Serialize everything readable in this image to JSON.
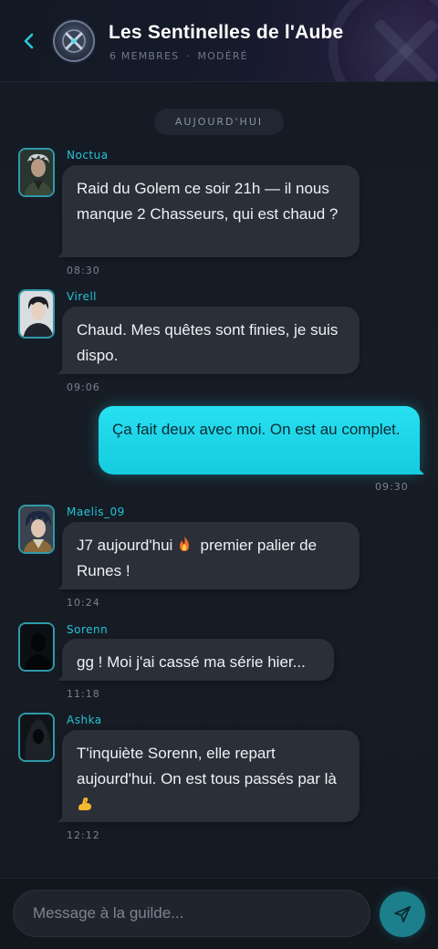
{
  "header": {
    "title": "Les Sentinelles de l'Aube",
    "members": "6 MEMBRES",
    "separator": "·",
    "moderation": "MODÉRÉ"
  },
  "day_divider": "AUJOURD'HUI",
  "messages": [
    {
      "sender": "Noctua",
      "text": "Raid du Golem ce soir 21h — il nous manque 2 Chasseurs, qui est chaud ?",
      "time": "08:30"
    },
    {
      "sender": "Virell",
      "text": "Chaud. Mes quêtes sont finies, je suis dispo.",
      "time": "09:06"
    },
    {
      "sender": "",
      "text": "Ça fait deux avec moi. On est au complet.",
      "time": "09:30"
    },
    {
      "sender": "Maelis_09",
      "text_before": "J7 aujourd'hui",
      "text_after": "premier palier de Runes !",
      "time": "10:24"
    },
    {
      "sender": "Sorenn",
      "text": "gg ! Moi j'ai cassé ma série hier...",
      "time": "11:18"
    },
    {
      "sender": "Ashka",
      "text": "T'inquiète Sorenn, elle repart aujourd'hui. On est tous passés par là",
      "time": "12:12"
    }
  ],
  "composer": {
    "placeholder": "Message à la guilde..."
  },
  "colors": {
    "accent": "#25c4d6",
    "outgoing_bubble": "#1fd6ea",
    "incoming_bubble": "#2a2f38"
  },
  "icons": {
    "back": "chevron-left-icon",
    "guild": "crossed-swords-emblem-icon",
    "fire": "fire-emoji-icon",
    "flex": "flexed-biceps-emoji-icon",
    "send": "send-icon"
  }
}
